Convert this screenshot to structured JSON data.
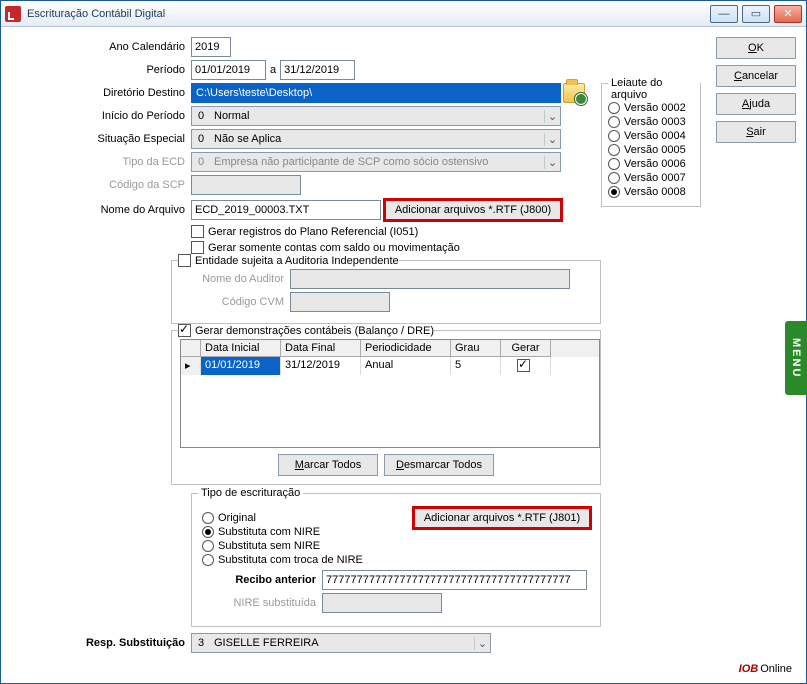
{
  "window": {
    "title": "Escrituração Contábil Digital"
  },
  "labels": {
    "ano": "Ano Calendário",
    "periodo": "Período",
    "a": "a",
    "dir": "Diretório Destino",
    "inicio": "Início do Período",
    "situacao": "Situação Especial",
    "tipoEcd": "Tipo da ECD",
    "codScp": "Código da SCP",
    "nomeArq": "Nome do Arquivo",
    "chkPlano": "Gerar registros do Plano Referencial (I051)",
    "chkSaldo": "Gerar somente contas com saldo ou movimentação",
    "chkAuditoria": "Entidade sujeita a Auditoria Independente",
    "nomeAuditor": "Nome do Auditor",
    "codCvm": "Código CVM",
    "chkDemo": "Gerar demonstrações contábeis (Balanço / DRE)",
    "marcar": "Marcar Todos",
    "desmarcar": "Desmarcar Todos",
    "tipoEsc": "Tipo de escrituração",
    "rOriginal": "Original",
    "rSubNire": "Substituta com NIRE",
    "rSemNire": "Substituta sem NIRE",
    "rTroca": "Substituta com troca de NIRE",
    "recibo": "Recibo anterior",
    "nireSub": "NIRE substituída",
    "respSub": "Resp. Substituição",
    "leiaute": "Leiaute do arquivo",
    "btnRtf800": "Adicionar arquivos *.RTF (J800)",
    "btnRtf801": "Adicionar arquivos *.RTF (J801)"
  },
  "values": {
    "ano": "2019",
    "periodoIni": "01/01/2019",
    "periodoFim": "31/12/2019",
    "dir": "C:\\Users\\teste\\Desktop\\",
    "inicioIdx": "0",
    "inicioTxt": "Normal",
    "situacaoIdx": "0",
    "situacaoTxt": "Não se Aplica",
    "tipoEcdIdx": "0",
    "tipoEcdTxt": "Empresa não participante de SCP como sócio ostensivo",
    "nomeArq": "ECD_2019_00003.TXT",
    "recibo": "7777777777777777777777777777777777777777",
    "respIdx": "3",
    "respTxt": "GISELLE FERREIRA"
  },
  "leiaute": [
    "Versão 0002",
    "Versão 0003",
    "Versão 0004",
    "Versão 0005",
    "Versão 0006",
    "Versão 0007",
    "Versão 0008"
  ],
  "tableHdr": {
    "c1": "Data Inicial",
    "c2": "Data Final",
    "c3": "Periodicidade",
    "c4": "Grau",
    "c5": "Gerar"
  },
  "tableRow": {
    "c1": "01/01/2019",
    "c2": "31/12/2019",
    "c3": "Anual",
    "c4": "5"
  },
  "rightBtns": {
    "ok": "OK",
    "cancelar": "Cancelar",
    "ajuda": "Ajuda",
    "sair": "Sair"
  },
  "footer": {
    "brand": "IOB",
    "txt": "Online"
  },
  "menuTab": "MENU",
  "underline": {
    "m": "M",
    "arcar": "arcar Todos",
    "d": "D",
    "esmarcar": "esmarcar Todos",
    "o": "O",
    "k": "K",
    "c": "C",
    "ancelar": "ancelar",
    "a2": "A",
    "juda": "juda",
    "s": "S",
    "air": "air"
  }
}
